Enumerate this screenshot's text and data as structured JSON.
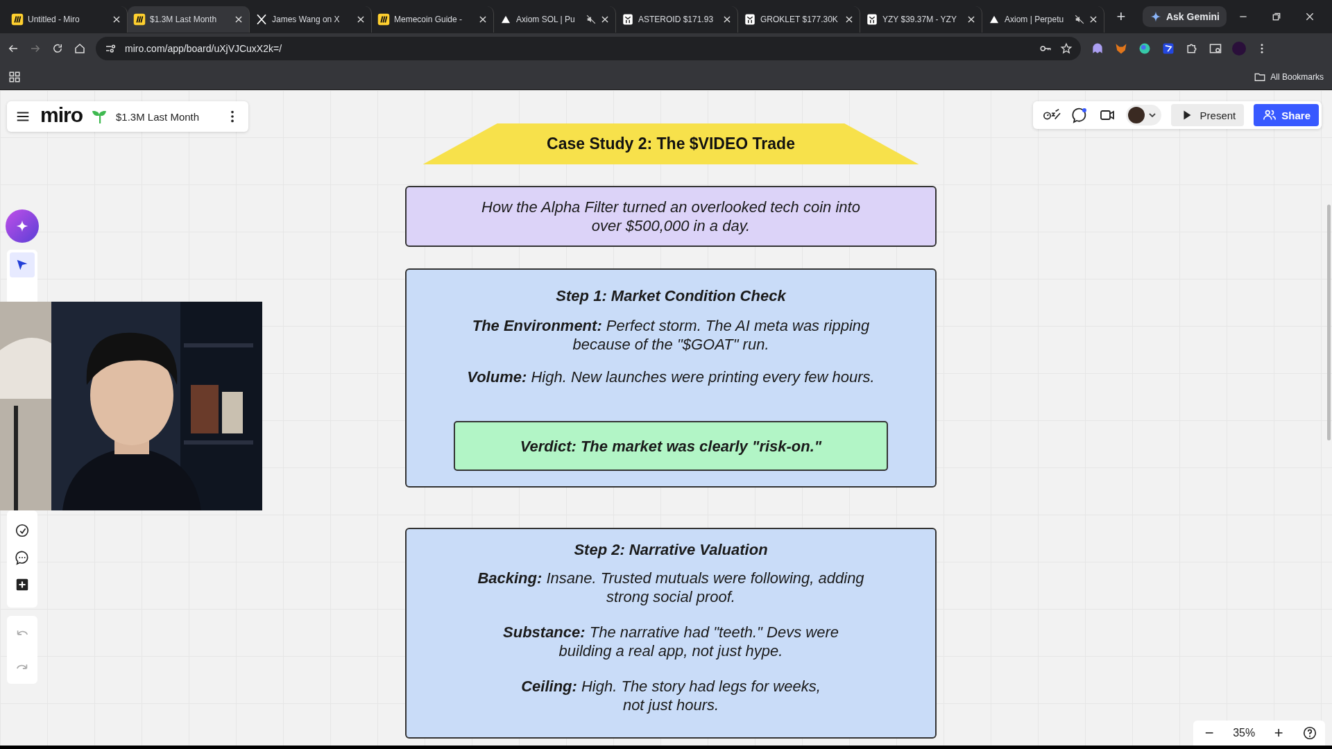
{
  "browser": {
    "tabs": [
      {
        "title": "Untitled - Miro",
        "kind": "miro",
        "muted": false,
        "selected": false
      },
      {
        "title": "$1.3M Last Month",
        "kind": "miro",
        "muted": false,
        "selected": true
      },
      {
        "title": "James Wang on X",
        "kind": "x",
        "muted": false,
        "selected": false
      },
      {
        "title": "Memecoin Guide -",
        "kind": "miro",
        "muted": false,
        "selected": false
      },
      {
        "title": "Axiom SOL | Pu",
        "kind": "axiom",
        "muted": true,
        "selected": false
      },
      {
        "title": "ASTEROID $171.93",
        "kind": "owl",
        "muted": false,
        "selected": false
      },
      {
        "title": "GROKLET $177.30K",
        "kind": "owl",
        "muted": false,
        "selected": false
      },
      {
        "title": "YZY $39.37M - YZY",
        "kind": "owl",
        "muted": false,
        "selected": false
      },
      {
        "title": "Axiom | Perpetu",
        "kind": "axiom",
        "muted": true,
        "selected": false
      }
    ],
    "new_tab": "+",
    "ask_gemini": "Ask Gemini",
    "address": "miro.com/app/board/uXjVJCuxX2k=/",
    "bookmarks_folder": "All Bookmarks"
  },
  "board": {
    "logo": "miro",
    "name": "$1.3M Last Month",
    "present": "Present",
    "share": "Share",
    "zoom_out": "−",
    "zoom": "35%",
    "zoom_in": "+",
    "title": "Case Study 2: The $VIDEO Trade",
    "intro": "How the Alpha Filter turned an overlooked tech coin into\nover $500,000 in a day.",
    "sections": [
      {
        "heading": "Step 1: Market Condition Check",
        "paragraphs": [
          "**The Environment:** Perfect storm. The AI meta was ripping\nbecause of the \"$GOAT\" run.",
          "**Volume:** High. New launches were printing every few hours."
        ],
        "verdict": "Verdict: The market was clearly \"risk-on.\""
      },
      {
        "heading": "Step 2: Narrative Valuation",
        "paragraphs": [
          "**Backing:** Insane. Trusted mutuals were following, adding\nstrong social proof.",
          "**Substance:** The narrative had \"teeth.\" Devs were\nbuilding a real app, not just hype.",
          "**Ceiling:** High. The story had legs for weeks,\nnot just hours."
        ]
      }
    ]
  }
}
